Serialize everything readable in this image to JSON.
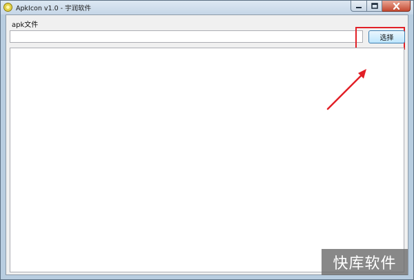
{
  "window": {
    "title": "ApkIcon v1.0 - 宇润软件",
    "controls": {
      "minimize_icon": "minimize-icon",
      "maximize_icon": "maximize-icon",
      "close_icon": "close-icon"
    }
  },
  "form": {
    "apk_label": "apk文件",
    "path_value": "",
    "select_button_label": "选择"
  },
  "annotation": {
    "highlight_color": "#e21f26",
    "arrow_color": "#e21f26"
  },
  "watermark": {
    "text": "快库软件"
  }
}
